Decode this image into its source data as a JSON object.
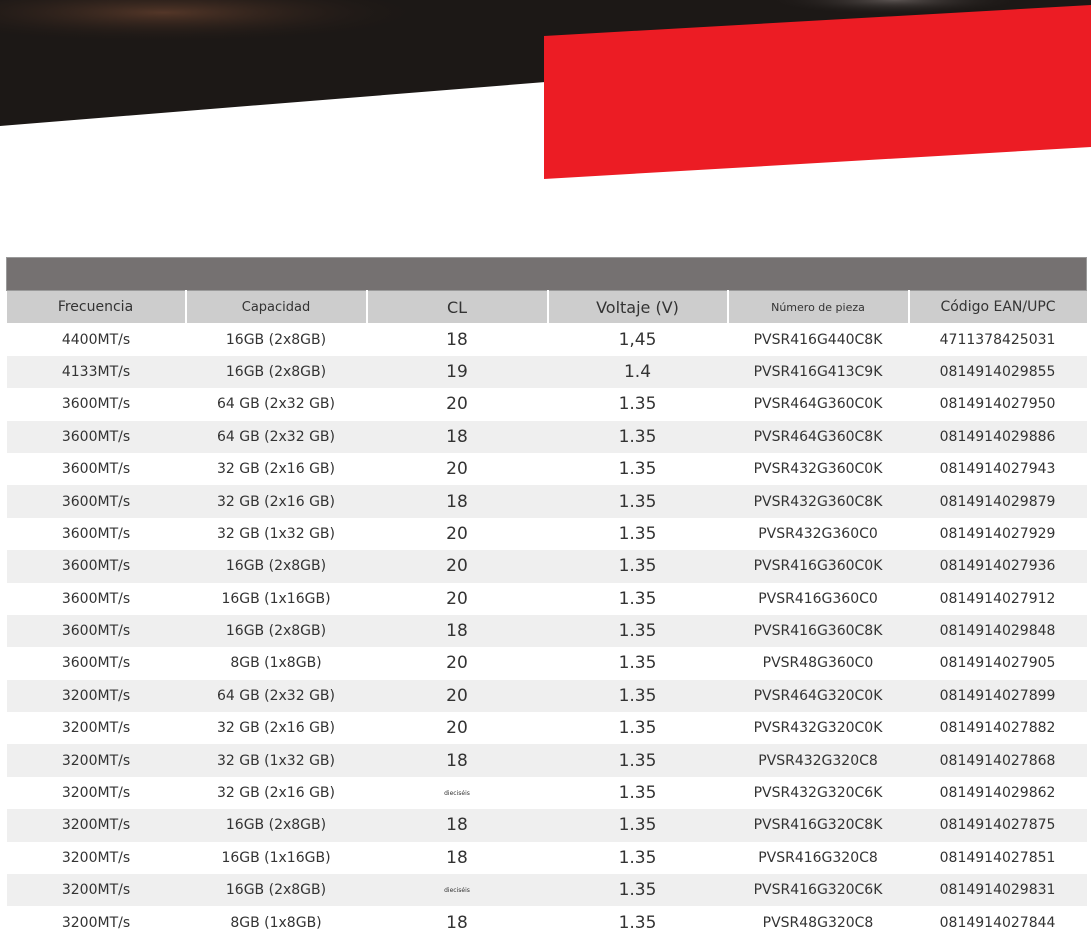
{
  "colors": {
    "accent": "#ec1c24",
    "dark_banner": "#1a1614",
    "title_bar": "#757171",
    "header": "#cdcdcd",
    "stripe": "#efefef"
  },
  "table": {
    "title": "",
    "headers": [
      "Frecuencia",
      "Capacidad",
      "CL",
      "Voltaje (V)",
      "Número de pieza",
      "Código EAN/UPC"
    ],
    "rows": [
      [
        "4400MT/s",
        "16GB (2x8GB)",
        "18",
        "1,45",
        "PVSR416G440C8K",
        "4711378425031"
      ],
      [
        "4133MT/s",
        "16GB (2x8GB)",
        "19",
        "1.4",
        "PVSR416G413C9K",
        "0814914029855"
      ],
      [
        "3600MT/s",
        "64 GB (2x32 GB)",
        "20",
        "1.35",
        "PVSR464G360C0K",
        "0814914027950"
      ],
      [
        "3600MT/s",
        "64 GB (2x32 GB)",
        "18",
        "1.35",
        "PVSR464G360C8K",
        "0814914029886"
      ],
      [
        "3600MT/s",
        "32 GB (2x16 GB)",
        "20",
        "1.35",
        "PVSR432G360C0K",
        "0814914027943"
      ],
      [
        "3600MT/s",
        "32 GB (2x16 GB)",
        "18",
        "1.35",
        "PVSR432G360C8K",
        "0814914029879"
      ],
      [
        "3600MT/s",
        "32 GB (1x32 GB)",
        "20",
        "1.35",
        "PVSR432G360C0",
        "0814914027929"
      ],
      [
        "3600MT/s",
        "16GB (2x8GB)",
        "20",
        "1.35",
        "PVSR416G360C0K",
        "0814914027936"
      ],
      [
        "3600MT/s",
        "16GB (1x16GB)",
        "20",
        "1.35",
        "PVSR416G360C0",
        "0814914027912"
      ],
      [
        "3600MT/s",
        "16GB (2x8GB)",
        "18",
        "1.35",
        "PVSR416G360C8K",
        "0814914029848"
      ],
      [
        "3600MT/s",
        "8GB (1x8GB)",
        "20",
        "1.35",
        "PVSR48G360C0",
        "0814914027905"
      ],
      [
        "3200MT/s",
        "64 GB (2x32 GB)",
        "20",
        "1.35",
        "PVSR464G320C0K",
        "0814914027899"
      ],
      [
        "3200MT/s",
        "32 GB (2x16 GB)",
        "20",
        "1.35",
        "PVSR432G320C0K",
        "0814914027882"
      ],
      [
        "3200MT/s",
        "32 GB (1x32 GB)",
        "18",
        "1.35",
        "PVSR432G320C8",
        "0814914027868"
      ],
      [
        "3200MT/s",
        "32 GB (2x16 GB)",
        "dieciséis",
        "1.35",
        "PVSR432G320C6K",
        "0814914029862"
      ],
      [
        "3200MT/s",
        "16GB (2x8GB)",
        "18",
        "1.35",
        "PVSR416G320C8K",
        "0814914027875"
      ],
      [
        "3200MT/s",
        "16GB (1x16GB)",
        "18",
        "1.35",
        "PVSR416G320C8",
        "0814914027851"
      ],
      [
        "3200MT/s",
        "16GB (2x8GB)",
        "dieciséis",
        "1.35",
        "PVSR416G320C6K",
        "0814914029831"
      ],
      [
        "3200MT/s",
        "8GB (1x8GB)",
        "18",
        "1.35",
        "PVSR48G320C8",
        "0814914027844"
      ]
    ]
  }
}
